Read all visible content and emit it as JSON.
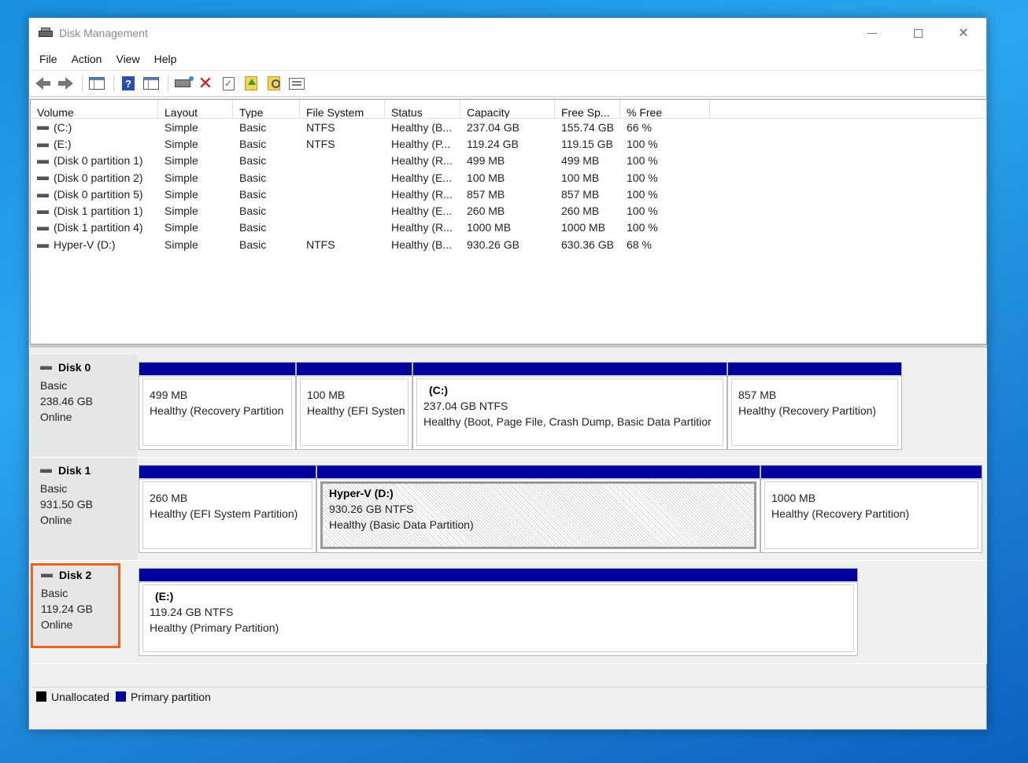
{
  "window": {
    "title": "Disk Management"
  },
  "menu": [
    "File",
    "Action",
    "View",
    "Help"
  ],
  "toolbar": [
    "back-icon",
    "forward-icon",
    "console-tree-icon",
    "help-icon",
    "details-view-icon",
    "connect-disk-icon",
    "delete-icon",
    "check-icon",
    "up-folder-icon",
    "search-folder-icon",
    "properties-icon"
  ],
  "volume_table": {
    "headers": [
      "Volume",
      "Layout",
      "Type",
      "File System",
      "Status",
      "Capacity",
      "Free Sp...",
      "% Free"
    ],
    "rows": [
      [
        "(C:)",
        "Simple",
        "Basic",
        "NTFS",
        "Healthy (B...",
        "237.04 GB",
        "155.74 GB",
        "66 %"
      ],
      [
        "(E:)",
        "Simple",
        "Basic",
        "NTFS",
        "Healthy (P...",
        "119.24 GB",
        "119.15 GB",
        "100 %"
      ],
      [
        "(Disk 0 partition 1)",
        "Simple",
        "Basic",
        "",
        "Healthy (R...",
        "499 MB",
        "499 MB",
        "100 %"
      ],
      [
        "(Disk 0 partition 2)",
        "Simple",
        "Basic",
        "",
        "Healthy (E...",
        "100 MB",
        "100 MB",
        "100 %"
      ],
      [
        "(Disk 0 partition 5)",
        "Simple",
        "Basic",
        "",
        "Healthy (R...",
        "857 MB",
        "857 MB",
        "100 %"
      ],
      [
        "(Disk 1 partition 1)",
        "Simple",
        "Basic",
        "",
        "Healthy (E...",
        "260 MB",
        "260 MB",
        "100 %"
      ],
      [
        "(Disk 1 partition 4)",
        "Simple",
        "Basic",
        "",
        "Healthy (R...",
        "1000 MB",
        "1000 MB",
        "100 %"
      ],
      [
        "Hyper-V (D:)",
        "Simple",
        "Basic",
        "NTFS",
        "Healthy (B...",
        "930.26 GB",
        "630.36 GB",
        "68 %"
      ]
    ]
  },
  "disks": [
    {
      "name": "Disk 0",
      "type": "Basic",
      "size": "238.46 GB",
      "status": "Online",
      "partitions": [
        {
          "label": "",
          "size": "499 MB",
          "status": "Healthy (Recovery Partition"
        },
        {
          "label": "",
          "size": "100 MB",
          "status": "Healthy (EFI Systen"
        },
        {
          "label": "(C:)",
          "size": "237.04 GB NTFS",
          "status": "Healthy (Boot, Page File, Crash Dump, Basic Data Partitior"
        },
        {
          "label": "",
          "size": "857 MB",
          "status": "Healthy (Recovery Partition)"
        }
      ]
    },
    {
      "name": "Disk 1",
      "type": "Basic",
      "size": "931.50 GB",
      "status": "Online",
      "partitions": [
        {
          "label": "",
          "size": "260 MB",
          "status": "Healthy (EFI System Partition)"
        },
        {
          "label": "Hyper-V  (D:)",
          "size": "930.26 GB NTFS",
          "status": "Healthy (Basic Data Partition)"
        },
        {
          "label": "",
          "size": "1000 MB",
          "status": "Healthy (Recovery Partition)"
        }
      ]
    },
    {
      "name": "Disk 2",
      "type": "Basic",
      "size": "119.24 GB",
      "status": "Online",
      "partitions": [
        {
          "label": "(E:)",
          "size": "119.24 GB NTFS",
          "status": "Healthy (Primary Partition)"
        }
      ]
    }
  ],
  "legend": [
    {
      "label": "Unallocated",
      "color": "#000000"
    },
    {
      "label": "Primary partition",
      "color": "#00009c"
    }
  ],
  "colors": {
    "partition_bar": "#00009c",
    "highlight_border": "#e8631c"
  }
}
